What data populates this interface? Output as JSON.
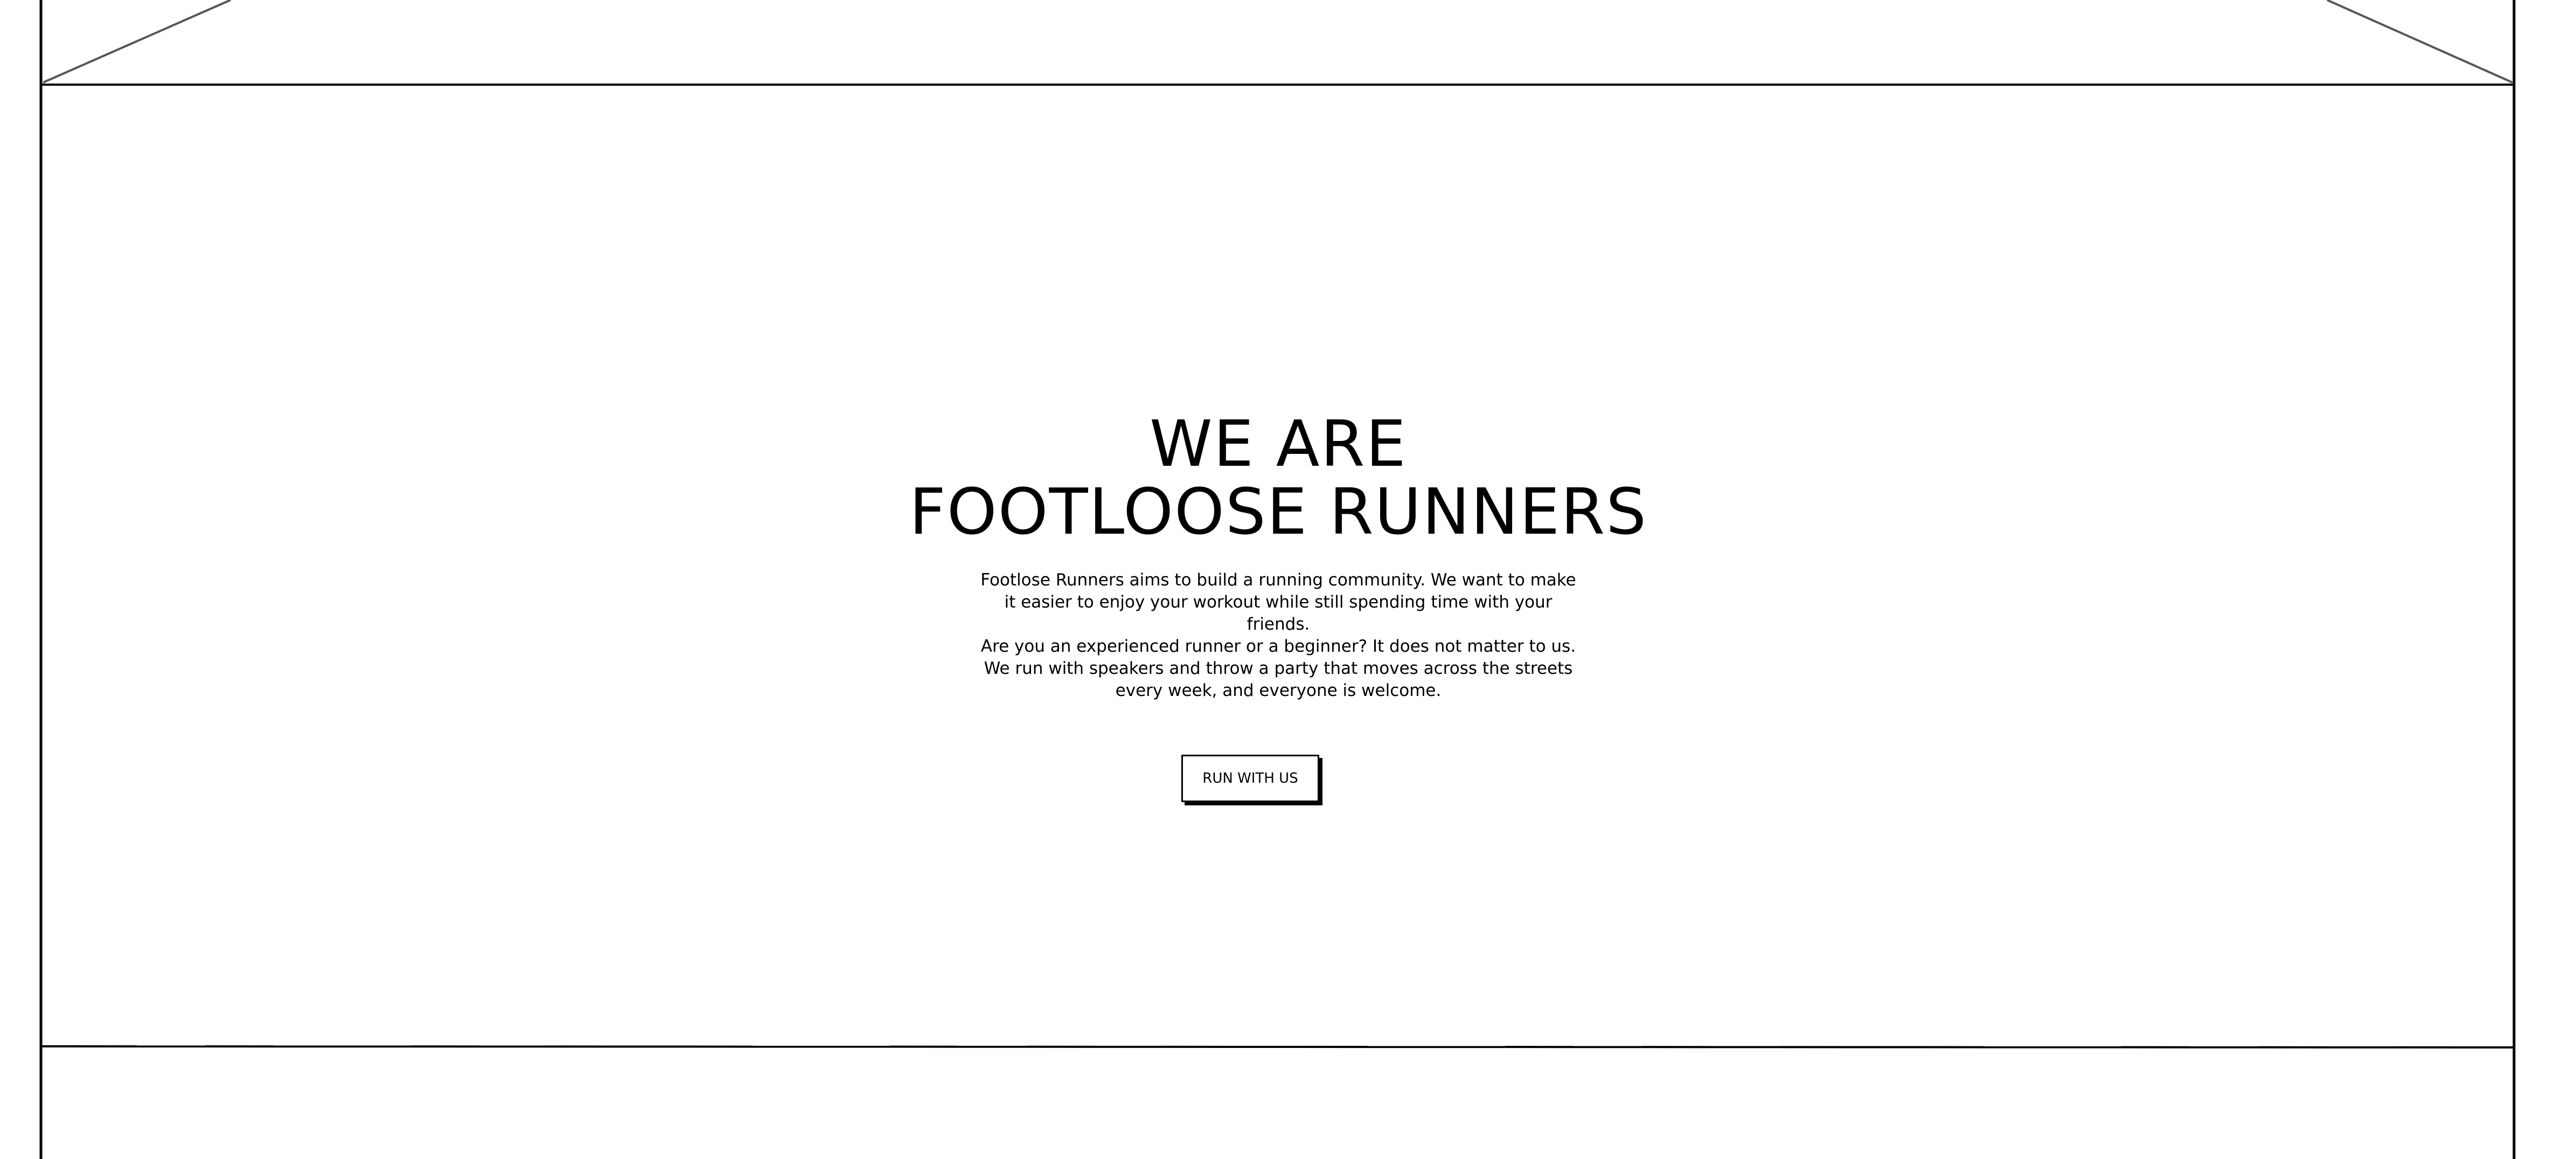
{
  "hero": {
    "title_line1": "WE ARE",
    "title_line2": "FOOTLOOSE RUNNERS",
    "description_lines": [
      "Footlose Runners aims to build a running community. We want to make",
      "it easier to enjoy your workout while still spending time with your friends.",
      "Are you an experienced runner or a beginner? It does not matter to us.",
      "We run with speakers and throw a party that moves across the streets",
      "every week, and everyone is welcome."
    ],
    "cta_label": "RUN WITH US"
  },
  "colors": {
    "line": "#000000",
    "placeholder_line": "#555555",
    "background": "#ffffff"
  }
}
